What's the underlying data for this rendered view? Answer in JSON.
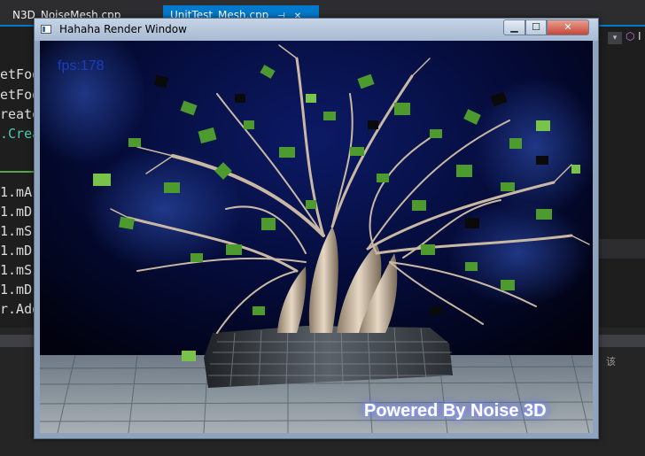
{
  "ide": {
    "tabs": [
      {
        "label": "N3D_NoiseMesh.cpp",
        "active": false
      },
      {
        "label": "UnitTest_Mesh.cpp",
        "active": true
      }
    ],
    "code_lines": [
      "etFog",
      "etFog",
      "reate",
      ".Crea",
      "1.mA",
      "1.mD",
      "1.mS",
      "1.mD",
      "1.mS",
      "1.mD",
      "r.Add"
    ],
    "right_letter": "I",
    "side_char": "该"
  },
  "window": {
    "title": "Hahaha Render Window",
    "controls": {
      "minimize": "▁",
      "maximize": "☐",
      "close": "✕"
    }
  },
  "render": {
    "fps_label": "fps:178",
    "watermark": "Powered By Noise 3D"
  },
  "colors": {
    "ide_accent": "#007acc",
    "ide_background": "#2d2d30",
    "fps_text": "#1a3cbf",
    "leaves": "#4d9a2f"
  }
}
